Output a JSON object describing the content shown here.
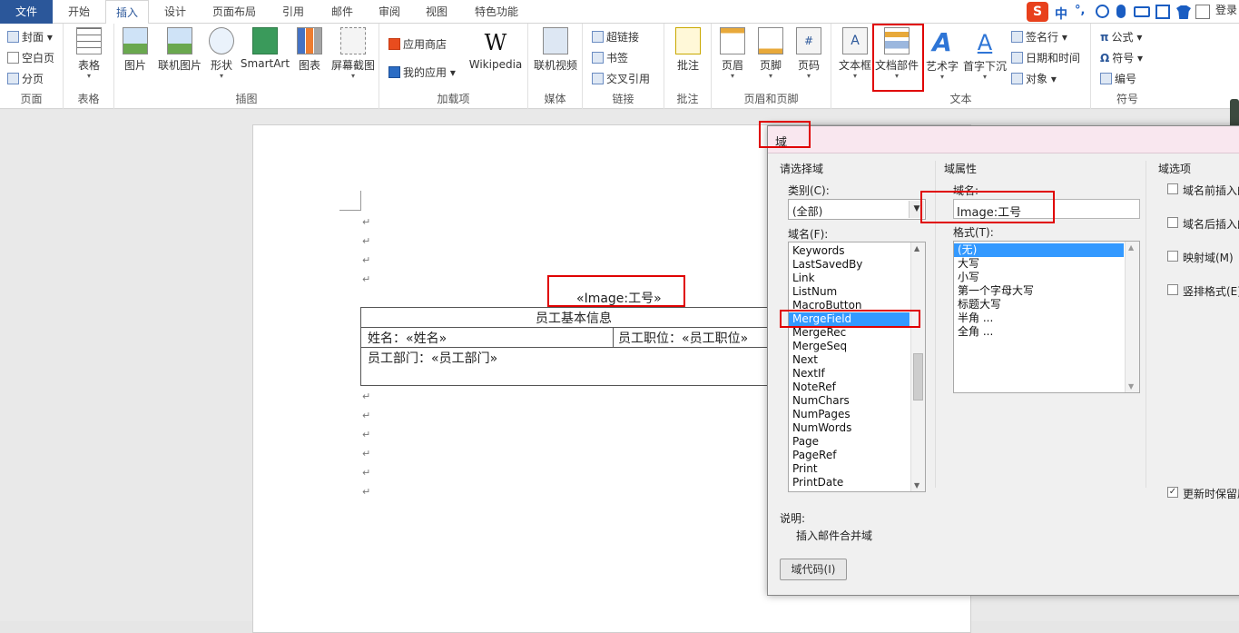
{
  "tabs": [
    "文件",
    "开始",
    "插入",
    "设计",
    "页面布局",
    "引用",
    "邮件",
    "审阅",
    "视图",
    "特色功能"
  ],
  "topright": {
    "ime_zh": "中",
    "ime_punct": "°,",
    "login": "登录"
  },
  "ribbon": {
    "pages": {
      "cover": "封面",
      "blank": "空白页",
      "break": "分页",
      "label": "页面"
    },
    "table": {
      "btn": "表格",
      "label": "表格"
    },
    "illus": {
      "picture": "图片",
      "online_picture": "联机图片",
      "shapes": "形状",
      "smartart": "SmartArt",
      "chart": "图表",
      "screenshot": "屏幕截图",
      "label": "插图"
    },
    "addins": {
      "store": "应用商店",
      "myapps": "我的应用",
      "wikipedia": "Wikipedia",
      "label": "加载项"
    },
    "media": {
      "video": "联机视频",
      "label": "媒体"
    },
    "links": {
      "hyperlink": "超链接",
      "bookmark": "书签",
      "crossref": "交叉引用",
      "label": "链接"
    },
    "comments": {
      "comment": "批注",
      "label": "批注"
    },
    "headerfooter": {
      "header": "页眉",
      "footer": "页脚",
      "pagenum": "页码",
      "label": "页眉和页脚"
    },
    "text": {
      "textbox": "文本框",
      "quickparts": "文档部件",
      "wordart": "艺术字",
      "dropcap": "首字下沉",
      "sigline": "签名行",
      "datetime": "日期和时间",
      "object": "对象",
      "label": "文本"
    },
    "symbols": {
      "equation": "公式",
      "symbol": "符号",
      "number": "编号",
      "label": "符号"
    }
  },
  "doc": {
    "field_text": "«Image:工号»",
    "table_title": "员工基本信息",
    "name_cell": "姓名：«姓名»",
    "position_cell": "员工职位：«员工职位»",
    "dept_cell": "员工部门：«员工部门»",
    "para_mark": "↵"
  },
  "dialog": {
    "title": "域",
    "choose_field": "请选择域",
    "category_label": "类别(C):",
    "category_value": "(全部)",
    "fieldname_label": "域名(F):",
    "field_names": [
      "Keywords",
      "LastSavedBy",
      "Link",
      "ListNum",
      "MacroButton",
      "MergeField",
      "MergeRec",
      "MergeSeq",
      "Next",
      "NextIf",
      "NoteRef",
      "NumChars",
      "NumPages",
      "NumWords",
      "Page",
      "PageRef",
      "Print",
      "PrintDate"
    ],
    "selected_field": "MergeField",
    "field_props": "域属性",
    "prop_name_label": "域名:",
    "prop_name_value": "Image:工号",
    "format_label": "格式(T):",
    "formats": [
      "(无)",
      "大写",
      "小写",
      "第一个字母大写",
      "标题大写",
      "半角 ...",
      "全角 ..."
    ],
    "field_options": "域选项",
    "opt1": "域名前插入的",
    "opt2": "域名后插入的",
    "opt3": "映射域(M)",
    "opt4": "竖排格式(E)",
    "preserve": "更新时保留原",
    "desc_label": "说明:",
    "desc_text": "插入邮件合并域",
    "field_codes_btn": "域代码(I)"
  }
}
